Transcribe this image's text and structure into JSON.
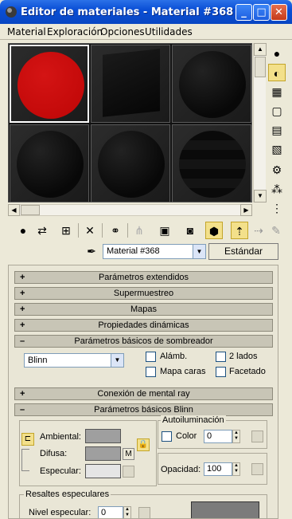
{
  "window": {
    "title": "Editor de materiales - Material #368",
    "controls": {
      "minimize": "_",
      "maximize": "□",
      "close": "✕"
    }
  },
  "menu": {
    "items": [
      {
        "label": "Material"
      },
      {
        "label": "Exploración"
      },
      {
        "label": "Opciones"
      },
      {
        "label": "Utilidades"
      }
    ]
  },
  "material_selector": {
    "value": "Material #368"
  },
  "type_button": {
    "label": "Estándar"
  },
  "rollouts": {
    "extended": {
      "label": "Parámetros extendidos",
      "sign": "+"
    },
    "supersampling": {
      "label": "Supermuestreo",
      "sign": "+"
    },
    "maps": {
      "label": "Mapas",
      "sign": "+"
    },
    "dynamics": {
      "label": "Propiedades dinámicas",
      "sign": "+"
    },
    "shader_basic": {
      "label": "Parámetros básicos de sombreador",
      "sign": "–"
    },
    "mental_ray": {
      "label": "Conexión de mental ray",
      "sign": "+"
    },
    "blinn_basic": {
      "label": "Parámetros básicos Blinn",
      "sign": "–"
    }
  },
  "shader": {
    "type_value": "Blinn",
    "wire_label": "Alámb.",
    "two_sided_label": "2 lados",
    "face_map_label": "Mapa caras",
    "faceted_label": "Facetado"
  },
  "blinn": {
    "ambient_label": "Ambiental:",
    "diffuse_label": "Difusa:",
    "specular_label": "Especular:",
    "map_button": "M",
    "self_illum_group": "Autoiluminación",
    "color_label": "Color",
    "self_illum_value": "0",
    "opacity_label": "Opacidad:",
    "opacity_value": "100",
    "spec_group": "Resaltes especulares",
    "spec_level_label": "Nivel especular:",
    "spec_level_value": "0"
  },
  "colors": {
    "title_bar": "#0a4fd6",
    "ambient": "#9f9f9f",
    "diffuse": "#9f9f9f",
    "specular": "#e5e5e5",
    "red_sample": "#c80a0a"
  }
}
